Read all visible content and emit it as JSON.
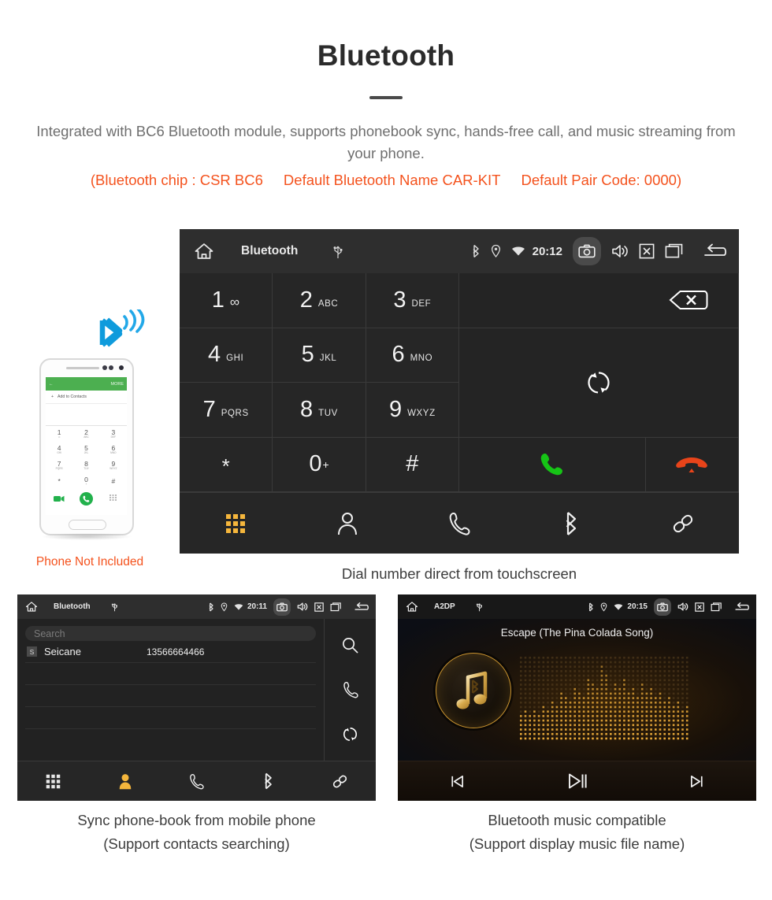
{
  "header": {
    "title": "Bluetooth",
    "subtitle": "Integrated with BC6 Bluetooth module, supports phonebook sync, hands-free call, and music streaming from your phone.",
    "spec_open": "(Bluetooth chip : CSR BC6",
    "spec_name": "Default Bluetooth Name CAR-KIT",
    "spec_code": "Default Pair Code: 0000)",
    "accent_color": "#f4521d",
    "text_color": "#6f6f6f"
  },
  "dialer": {
    "statusbar": {
      "home_icon": "home-icon",
      "title": "Bluetooth",
      "usb_icon": "usb-icon",
      "bluetooth_icon": "bluetooth-icon",
      "location_icon": "location-icon",
      "wifi_icon": "wifi-icon",
      "time": "20:12",
      "camera_icon": "camera-icon",
      "volume_icon": "volume-icon",
      "close_icon": "close-box-icon",
      "recents_icon": "recents-icon",
      "back_icon": "back-icon"
    },
    "keys": [
      {
        "num": "1",
        "sub": "∞",
        "sub_kind": "dots"
      },
      {
        "num": "2",
        "sub": "ABC",
        "sub_kind": "text"
      },
      {
        "num": "3",
        "sub": "DEF",
        "sub_kind": "text"
      },
      {
        "num": "4",
        "sub": "GHI",
        "sub_kind": "text"
      },
      {
        "num": "5",
        "sub": "JKL",
        "sub_kind": "text"
      },
      {
        "num": "6",
        "sub": "MNO",
        "sub_kind": "text"
      },
      {
        "num": "7",
        "sub": "PQRS",
        "sub_kind": "text"
      },
      {
        "num": "8",
        "sub": "TUV",
        "sub_kind": "text"
      },
      {
        "num": "9",
        "sub": "WXYZ",
        "sub_kind": "text"
      },
      {
        "num": "*",
        "sub": "",
        "sub_kind": "none"
      },
      {
        "num": "0",
        "sub": "+",
        "sub_kind": "sup"
      },
      {
        "num": "#",
        "sub": "",
        "sub_kind": "none"
      }
    ],
    "backspace_icon": "backspace-icon",
    "refresh_icon": "refresh-icon",
    "call_icon": "call-icon",
    "hangup_icon": "hangup-icon",
    "call_color": "#16c416",
    "hangup_color": "#e8441a",
    "tabs": [
      {
        "icon": "keypad-icon",
        "active": true
      },
      {
        "icon": "contact-icon",
        "active": false
      },
      {
        "icon": "phone-icon",
        "active": false
      },
      {
        "icon": "bluetooth-icon",
        "active": false
      },
      {
        "icon": "link-icon",
        "active": false
      }
    ],
    "active_tab_color": "#f5b63c",
    "caption": "Dial number direct from touchscreen"
  },
  "phone_mock": {
    "bluetooth_signal_icon": "bluetooth-signal-icon",
    "bluetooth_signal_color": "#1ba1e2",
    "screen_header_back": "←",
    "screen_header_more": "MORE",
    "add_to_contacts": "Add to Contacts",
    "keys": [
      {
        "num": "1",
        "sub": "∞"
      },
      {
        "num": "2",
        "sub": "ABC"
      },
      {
        "num": "3",
        "sub": "DEF"
      },
      {
        "num": "4",
        "sub": "GHI"
      },
      {
        "num": "5",
        "sub": "JKL"
      },
      {
        "num": "6",
        "sub": "MNO"
      },
      {
        "num": "7",
        "sub": "PQRS"
      },
      {
        "num": "8",
        "sub": "TUV"
      },
      {
        "num": "9",
        "sub": "WXYZ"
      },
      {
        "num": "*",
        "sub": ""
      },
      {
        "num": "0",
        "sub": "+"
      },
      {
        "num": "#",
        "sub": ""
      }
    ],
    "caption": "Phone Not Included",
    "caption_color": "#f4521d"
  },
  "phonebook": {
    "statusbar": {
      "home_icon": "home-icon",
      "title": "Bluetooth",
      "usb_icon": "usb-icon",
      "time": "20:11"
    },
    "search_placeholder": "Search",
    "contacts": [
      {
        "badge": "S",
        "name": "Seicane",
        "number": "13566664466"
      }
    ],
    "side_icons": [
      "search-icon",
      "phone-icon",
      "refresh-icon"
    ],
    "tabs": [
      {
        "icon": "keypad-icon",
        "active": false
      },
      {
        "icon": "contact-icon",
        "active": true
      },
      {
        "icon": "phone-icon",
        "active": false
      },
      {
        "icon": "bluetooth-icon",
        "active": false
      },
      {
        "icon": "link-icon",
        "active": false
      }
    ],
    "caption_line1": "Sync phone-book from mobile phone",
    "caption_line2": "(Support contacts searching)"
  },
  "music": {
    "statusbar": {
      "home_icon": "home-icon",
      "title": "A2DP",
      "usb_icon": "usb-icon",
      "time": "20:15"
    },
    "song_title": "Escape (The Pina Colada Song)",
    "album_art_icon": "music-note-bluetooth-icon",
    "visualizer": "dot-matrix-spectrum",
    "controls": [
      {
        "icon": "previous-track-icon"
      },
      {
        "icon": "play-pause-icon"
      },
      {
        "icon": "next-track-icon"
      }
    ],
    "caption_line1": "Bluetooth music compatible",
    "caption_line2": "(Support display music file name)"
  }
}
